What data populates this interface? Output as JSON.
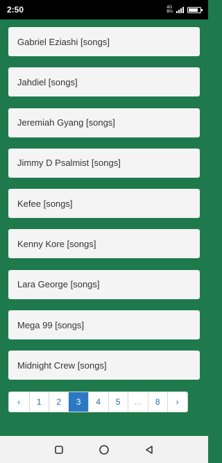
{
  "status_bar": {
    "time": "2:50",
    "network_top": "4G",
    "network_bottom": "B/s",
    "battery_level": 0.8
  },
  "artists": [
    {
      "label": "Gabriel Eziashi [songs]"
    },
    {
      "label": "Jahdiel [songs]"
    },
    {
      "label": "Jeremiah Gyang [songs]"
    },
    {
      "label": "Jimmy D Psalmist [songs]"
    },
    {
      "label": "Kefee [songs]"
    },
    {
      "label": "Kenny Kore [songs]"
    },
    {
      "label": "Lara George [songs]"
    },
    {
      "label": "Mega 99 [songs]"
    },
    {
      "label": "Midnight Crew [songs]"
    }
  ],
  "pagination": {
    "prev": "‹",
    "pages": [
      "1",
      "2",
      "3",
      "4",
      "5"
    ],
    "ellipsis": "...",
    "last": "8",
    "next": "›",
    "current": "3"
  },
  "nav_bar": {
    "icons": [
      "recents-icon",
      "home-icon",
      "back-icon"
    ]
  },
  "colors": {
    "background": "#1e7a4c",
    "item_background": "#f4f4f4",
    "active_page": "#2b79c2"
  }
}
